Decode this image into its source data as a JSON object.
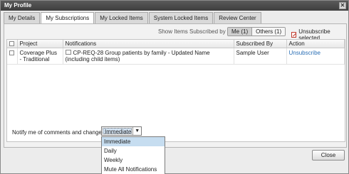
{
  "window": {
    "title": "My Profile",
    "close_glyph": "✕"
  },
  "tabs": [
    {
      "label": "My Details",
      "active": false
    },
    {
      "label": "My Subscriptions",
      "active": true
    },
    {
      "label": "My Locked Items",
      "active": false
    },
    {
      "label": "System Locked Items",
      "active": false
    },
    {
      "label": "Review Center",
      "active": false
    }
  ],
  "toolbar": {
    "show_label": "Show Items Subscribed by",
    "me_label": "Me (1)",
    "others_label": "Others (1)",
    "unsubscribe_selected": "Unsubscribe selected"
  },
  "table": {
    "columns": [
      "",
      "Project",
      "Notifications",
      "Subscribed By",
      "Action"
    ],
    "rows": [
      {
        "project": "Coverage Plus - Traditional",
        "notification": "CP-REQ-28 Group patients by family - Updated Name (including child items)",
        "subscribed_by": "Sample User",
        "action": "Unsubscribe"
      }
    ]
  },
  "notify": {
    "label": "Notify me of comments and changes:",
    "selected": "Immediate",
    "options": [
      "Immediate",
      "Daily",
      "Weekly",
      "Mute All Notifications"
    ]
  },
  "footer": {
    "close_label": "Close"
  },
  "colors": {
    "link": "#2a6fb5",
    "titlebar": "#4a4a4a",
    "selection": "#c6ddf0"
  }
}
